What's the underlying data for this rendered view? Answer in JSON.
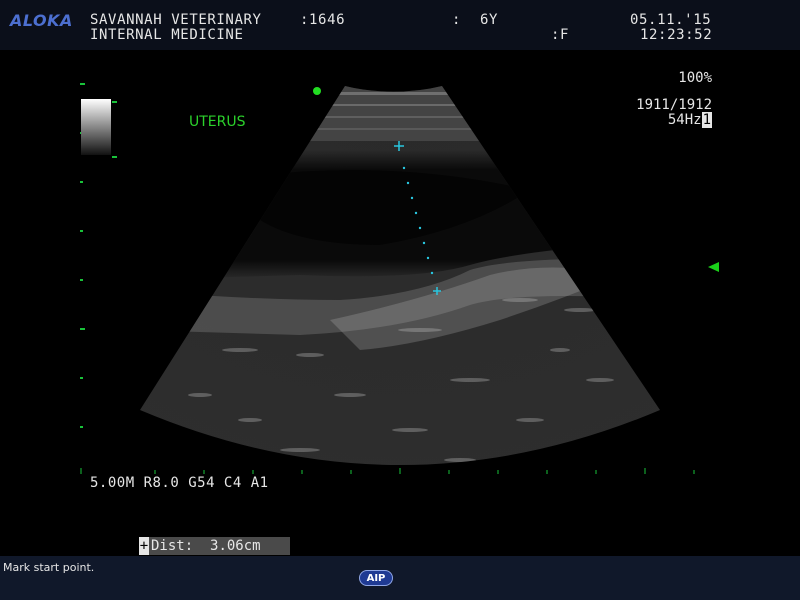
{
  "header": {
    "logo": "ALOKA",
    "facility": "SAVANNAH VETERINARY",
    "department": "INTERNAL MEDICINE",
    "id_field": ":1646",
    "age_colon": ":",
    "age": "6Y",
    "sex": ":F",
    "date": "05.11.'15",
    "time": "12:23:52"
  },
  "image_info": {
    "label": "UTERUS",
    "gain_percent": "100%",
    "frame_count": "1911/1912",
    "frame_rate": "54Hz",
    "frame_rate_marker": "1"
  },
  "params": {
    "text": "5.00M R8.0 G54 C4 A1"
  },
  "measurement": {
    "cursor": "+",
    "label": "Dist:",
    "value": "3.06cm"
  },
  "status": {
    "message": "Mark start point."
  },
  "buttons": {
    "aip": "AIP"
  },
  "colors": {
    "accent_green": "#22dd22",
    "caliper_cyan": "#29c7e0",
    "logo_blue": "#4c6fd0"
  }
}
